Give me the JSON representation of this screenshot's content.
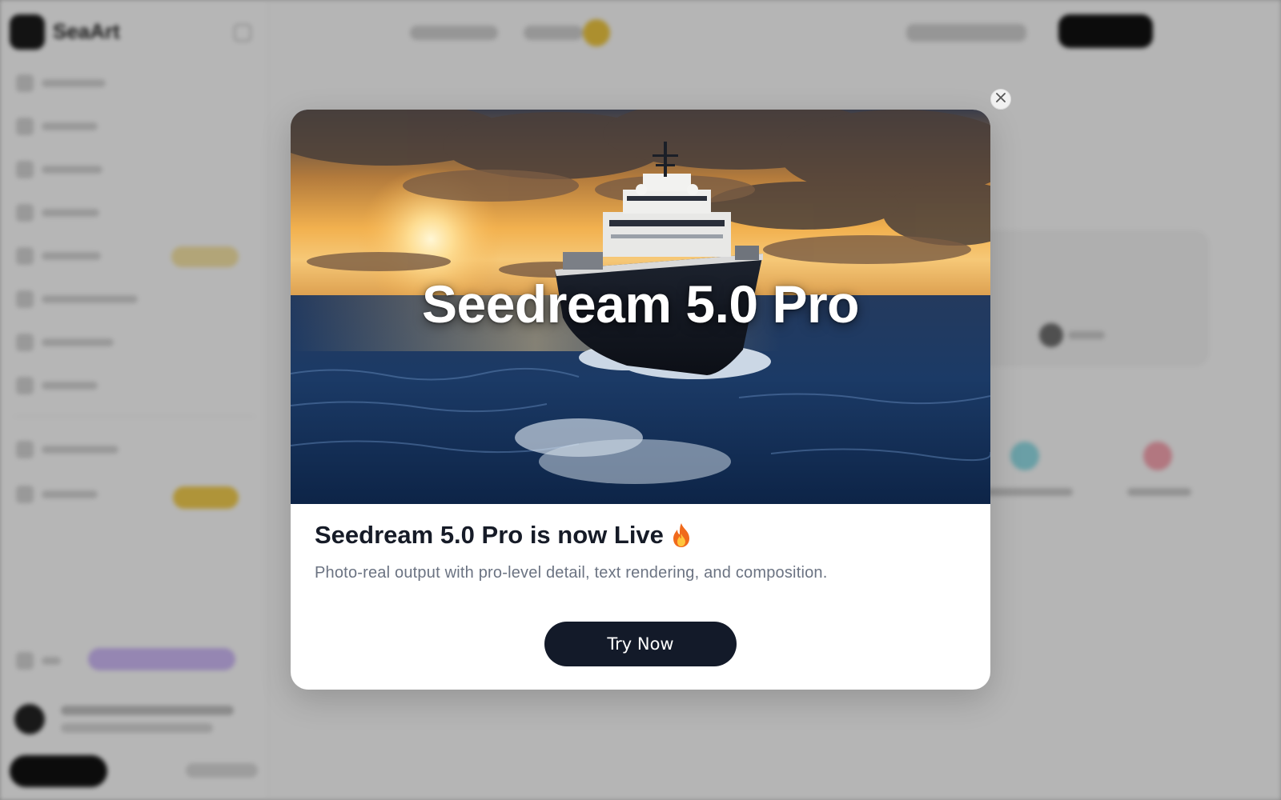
{
  "background_app": {
    "logo_text": "SeaArt"
  },
  "modal": {
    "hero_title": "Seedream 5.0 Pro",
    "heading": "Seedream 5.0 Pro is now Live",
    "heading_icon": "fire-icon",
    "description": "Photo-real output with pro-level detail, text rendering, and composition.",
    "cta_label": "Try Now",
    "close_icon": "close-icon"
  },
  "colors": {
    "cta_background": "#131a29",
    "heading_text": "#161b27",
    "description_text": "#6b7382",
    "overlay_tint": "#b9b9b9"
  }
}
